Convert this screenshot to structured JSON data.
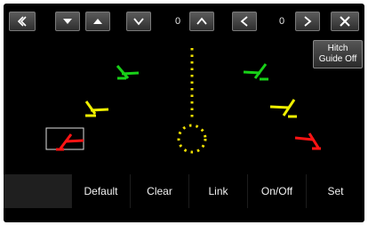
{
  "toolbar": {
    "back_icon": "double-chevron-left-icon",
    "left_down_icon": "triangle-down-icon",
    "left_up_icon": "triangle-up-icon",
    "vertical_down_icon": "chevron-down-icon",
    "vertical_value": "0",
    "vertical_up_icon": "chevron-up-icon",
    "horizontal_left_icon": "chevron-left-icon",
    "horizontal_value": "0",
    "horizontal_right_icon": "chevron-right-icon",
    "close_icon": "close-icon"
  },
  "hitch_button": {
    "line1": "Hitch",
    "line2": "Guide Off"
  },
  "guide": {
    "colors": {
      "green": "#18d018",
      "yellow": "#f0f000",
      "red": "#ff1414",
      "center_dots": "#f0e000"
    }
  },
  "bottom_bar": {
    "default_label": "Default",
    "clear_label": "Clear",
    "link_label": "Link",
    "onoff_label": "On/Off",
    "set_label": "Set"
  }
}
